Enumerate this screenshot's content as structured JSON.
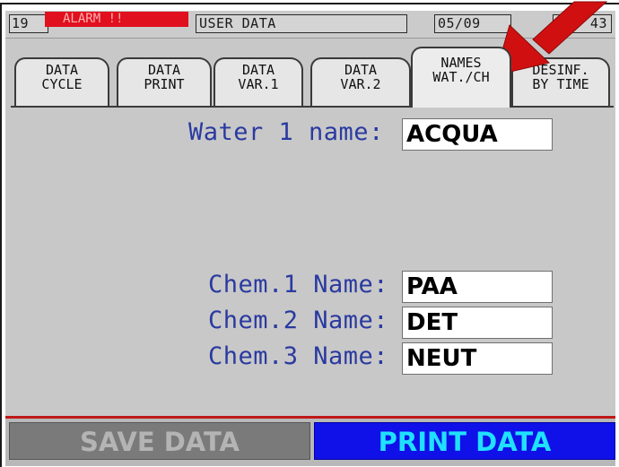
{
  "status_bar": {
    "number": "19",
    "alarm": "ALARM !!",
    "title": "USER DATA",
    "date": "05/09",
    "time": "09 43"
  },
  "tabs": [
    {
      "line1": "DATA",
      "line2": "CYCLE"
    },
    {
      "line1": "DATA",
      "line2": "PRINT"
    },
    {
      "line1": "DATA",
      "line2": "VAR.1"
    },
    {
      "line1": "DATA",
      "line2": "VAR.2"
    },
    {
      "line1": "NAMES",
      "line2": "WAT./CH",
      "active": true
    },
    {
      "line1": "DESINF.",
      "line2": "BY TIME"
    }
  ],
  "form": {
    "water1_label": "Water 1 name:",
    "water1_value": "ACQUA",
    "chem1_label": "Chem.1 Name:",
    "chem1_value": "PAA",
    "chem2_label": "Chem.2 Name:",
    "chem2_value": "DET",
    "chem3_label": "Chem.3 Name:",
    "chem3_value": "NEUT"
  },
  "buttons": {
    "save": "SAVE DATA",
    "print": "PRINT DATA"
  },
  "colors": {
    "alarm": "#e0101e",
    "label": "#2a3aa0",
    "print_button": "#1010e8",
    "print_text": "#20e0ff",
    "save_button": "#7a7a7a",
    "arrow": "#d01010"
  },
  "annotation": {
    "arrow_icon": "red-arrow-pointing-to-names-tab"
  }
}
